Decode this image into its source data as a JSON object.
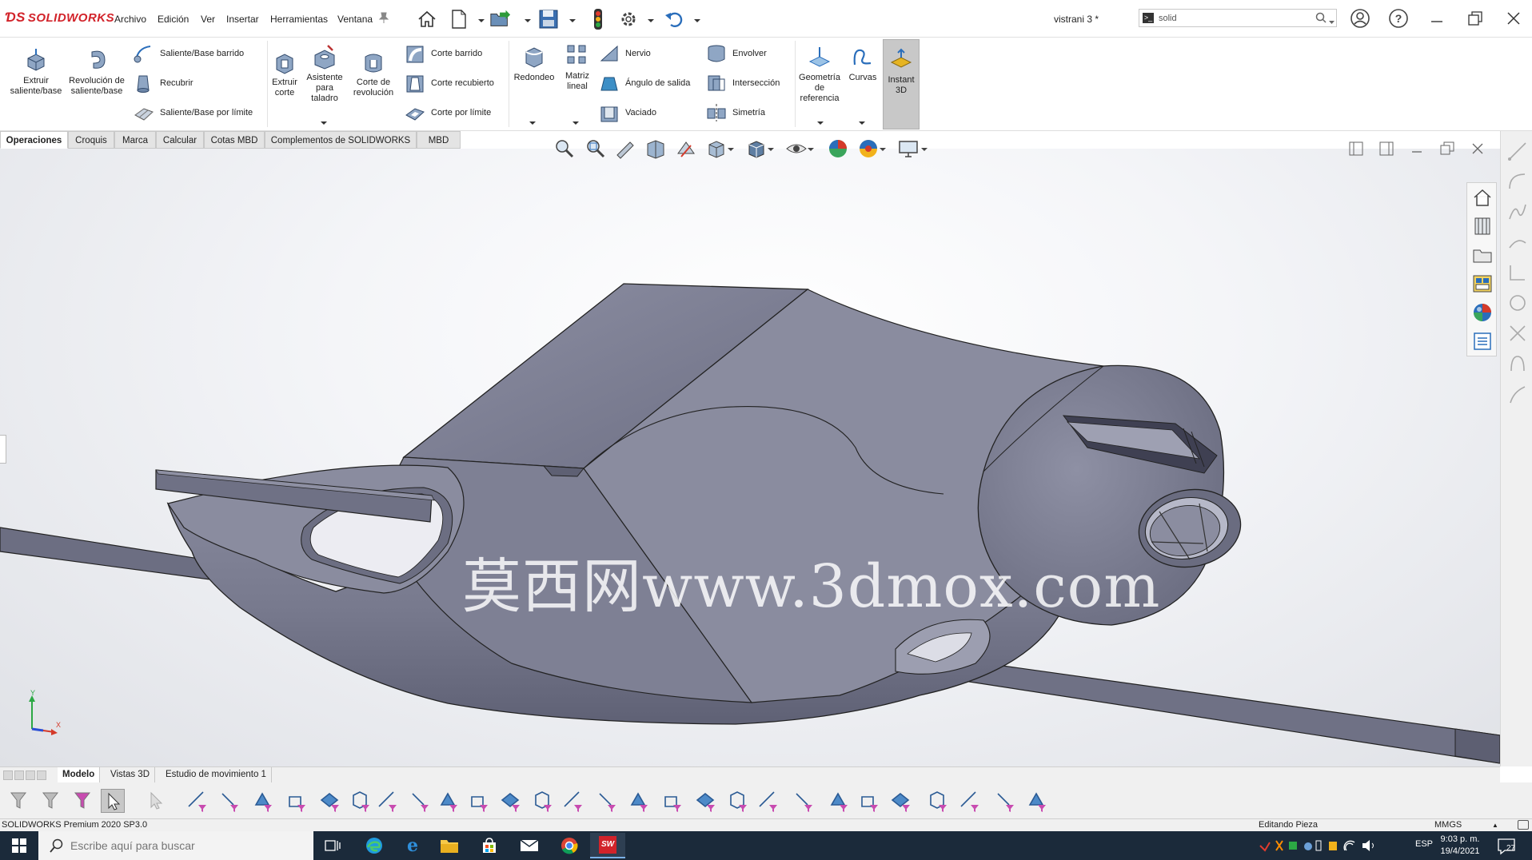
{
  "app": {
    "brand": "SOLIDWORKS",
    "document_title": "vistrani 3 *"
  },
  "menu": [
    "Archivo",
    "Edición",
    "Ver",
    "Insertar",
    "Herramientas",
    "Ventana"
  ],
  "search": {
    "value": "solid"
  },
  "ribbon": {
    "extrude_boss": "Extruir saliente/base",
    "revolve_boss": "Revolución de saliente/base",
    "swept_boss": "Saliente/Base barrido",
    "loft": "Recubrir",
    "boundary_boss": "Saliente/Base por límite",
    "extrude_cut": "Extruir corte",
    "hole_wizard": "Asistente para taladro",
    "revolve_cut": "Corte de revolución",
    "swept_cut": "Corte barrido",
    "lofted_cut": "Corte recubierto",
    "boundary_cut": "Corte por límite",
    "fillet": "Redondeo",
    "linear_pattern": "Matriz lineal",
    "rib": "Nervio",
    "draft": "Ángulo de salida",
    "shell": "Vaciado",
    "wrap": "Envolver",
    "intersect": "Intersección",
    "mirror": "Simetría",
    "ref_geometry": "Geometría de referencia",
    "curves": "Curvas",
    "instant3d": "Instant 3D"
  },
  "command_tabs": [
    "Operaciones",
    "Croquis",
    "Marca",
    "Calcular",
    "Cotas MBD",
    "Complementos de SOLIDWORKS",
    "MBD"
  ],
  "watermark": "莫西网www.3dmox.com",
  "triad": {
    "y": "Y",
    "x": "X"
  },
  "bottom_tabs": [
    "Modelo",
    "Vistas 3D",
    "Estudio de movimiento 1"
  ],
  "status": {
    "product": "SOLIDWORKS Premium 2020 SP3.0",
    "mode": "Editando Pieza",
    "units": "MMGS"
  },
  "taskbar": {
    "search_placeholder": "Escribe aquí para buscar",
    "lang": "ESP",
    "time": "9:03 p. m.",
    "date": "19/4/2021",
    "notifications": "27"
  },
  "colors": {
    "brand_red": "#d2232a",
    "model_gray": "#7f8094",
    "taskbar": "#1b2a3a",
    "accent_blue": "#2a6ebb"
  }
}
